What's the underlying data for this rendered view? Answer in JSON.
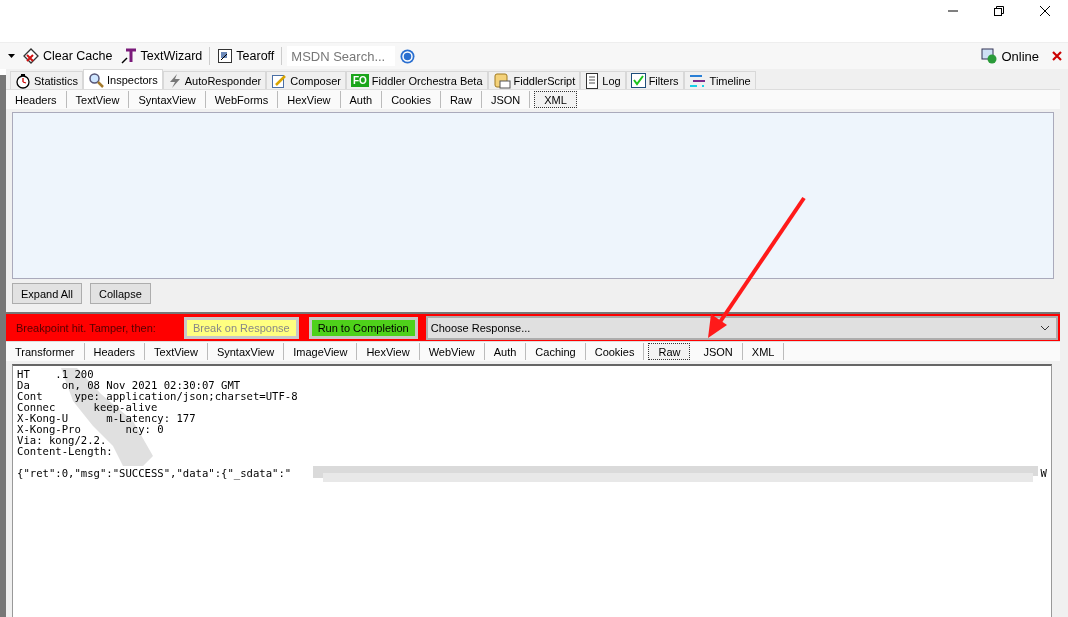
{
  "toolbar": {
    "items": [
      {
        "kind": "clear",
        "label": "Clear Cache"
      },
      {
        "kind": "wizard",
        "label": "TextWizard"
      },
      {
        "kind": "tearoff",
        "label": "Tearoff"
      }
    ],
    "search": {
      "placeholder": "MSDN Search..."
    },
    "status": "Online"
  },
  "tabs": [
    {
      "kind": "stopwatch",
      "label": "Statistics",
      "selected": false
    },
    {
      "kind": "magnifier",
      "label": "Inspectors",
      "selected": true
    },
    {
      "kind": "bolt",
      "label": "AutoResponder",
      "selected": false
    },
    {
      "kind": "pencil",
      "label": "Composer",
      "selected": false
    },
    {
      "kind": "badge",
      "badge": "FO",
      "label": "Fiddler Orchestra Beta",
      "selected": false
    },
    {
      "kind": "scroll",
      "label": "FiddlerScript",
      "selected": false
    },
    {
      "kind": "page",
      "label": "Log",
      "selected": false
    },
    {
      "kind": "check",
      "label": "Filters",
      "selected": false
    },
    {
      "kind": "timeline",
      "label": "Timeline",
      "selected": false
    }
  ],
  "request_tabs": [
    {
      "label": "Headers",
      "selected": false
    },
    {
      "label": "TextView",
      "selected": false
    },
    {
      "label": "SyntaxView",
      "selected": false
    },
    {
      "label": "WebForms",
      "selected": false
    },
    {
      "label": "HexView",
      "selected": false
    },
    {
      "label": "Auth",
      "selected": false
    },
    {
      "label": "Cookies",
      "selected": false
    },
    {
      "label": "Raw",
      "selected": false
    },
    {
      "label": "JSON",
      "selected": false
    },
    {
      "label": "XML",
      "selected": true
    }
  ],
  "tree_buttons": [
    "Expand All",
    "Collapse"
  ],
  "breakpoint": {
    "message": "Breakpoint hit. Tamper, then:",
    "break_button": {
      "label": "Break on Response",
      "disabled": true
    },
    "run_button": "Run to Completion",
    "response_select": "Choose Response..."
  },
  "response_tabs": [
    {
      "label": "Transformer",
      "selected": false
    },
    {
      "label": "Headers",
      "selected": false
    },
    {
      "label": "TextView",
      "selected": false
    },
    {
      "label": "SyntaxView",
      "selected": false
    },
    {
      "label": "ImageView",
      "selected": false
    },
    {
      "label": "HexView",
      "selected": false
    },
    {
      "label": "WebView",
      "selected": false
    },
    {
      "label": "Auth",
      "selected": false
    },
    {
      "label": "Caching",
      "selected": false
    },
    {
      "label": "Cookies",
      "selected": false
    },
    {
      "label": "Raw",
      "selected": true
    },
    {
      "label": "JSON",
      "selected": false
    },
    {
      "label": "XML",
      "selected": false
    }
  ],
  "response_headers": [
    {
      "text": "HT",
      "after": ".1 200"
    },
    {
      "text": "Da",
      "after": "on, 08 Nov 2021 02:30:07 GMT"
    },
    {
      "text": "Cont",
      "after": "ype: application/json;charset=UTF-8"
    },
    {
      "text": "Connec",
      "after": "keep-alive"
    },
    {
      "text": "X-Kong-U",
      "after": "m-Latency: 177"
    },
    {
      "text": "X-Kong-Pro",
      "after": "ncy: 0"
    },
    {
      "text": "Via: kong/2.2."
    },
    {
      "text": "Content-Length:"
    }
  ],
  "response_body": {
    "text": "{\"ret\":0,\"msg\":\"SUCCESS\",\"data\":{\"_sdata\":\"",
    "end": "W"
  }
}
